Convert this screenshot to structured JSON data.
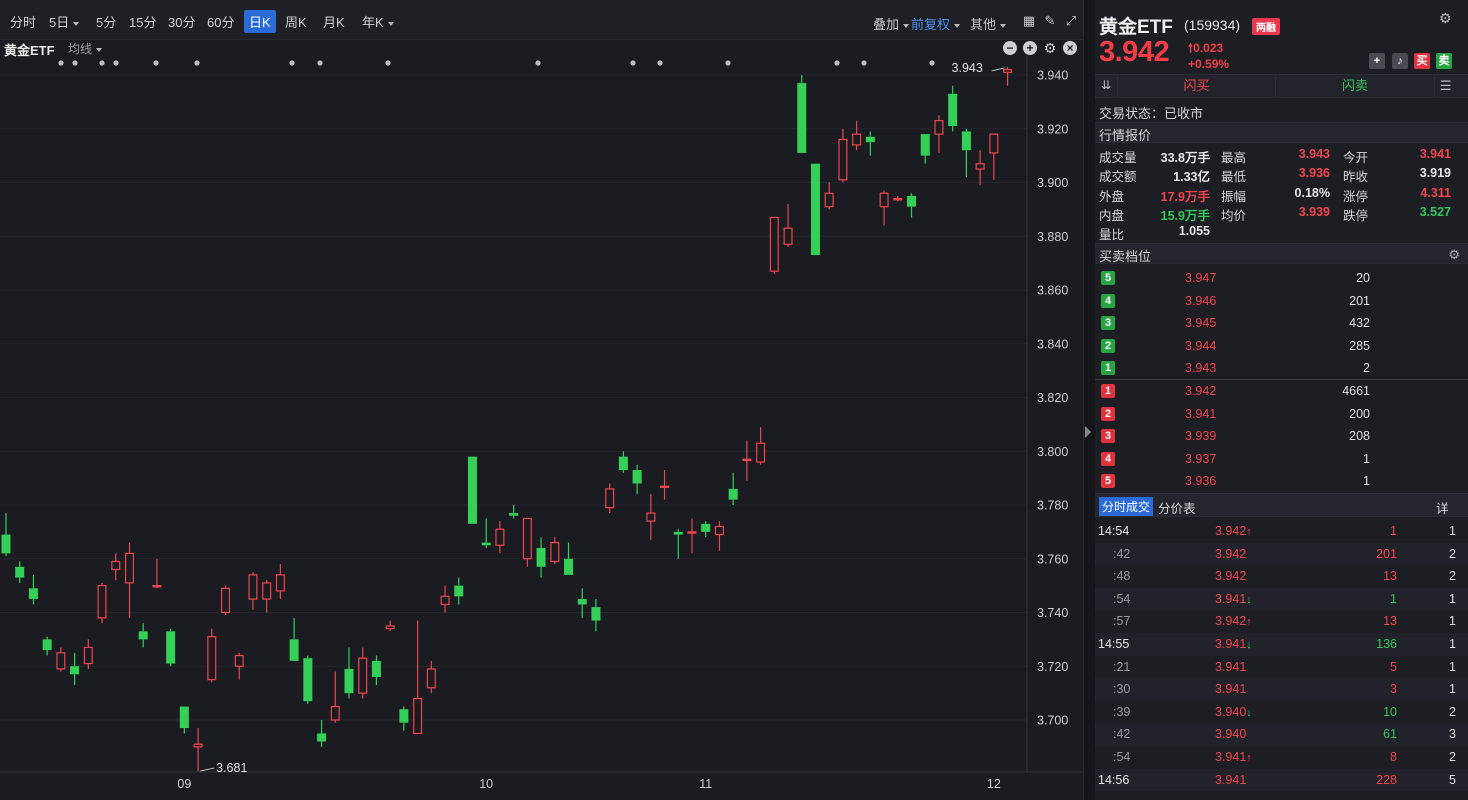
{
  "toolbar": {
    "periods": [
      "分时",
      "5日",
      "5分",
      "15分",
      "30分",
      "60分",
      "日K",
      "周K",
      "月K",
      "年K"
    ],
    "active_period": "日K",
    "overlay_label": "叠加",
    "adjust_label": "前复权",
    "other_label": "其他"
  },
  "chart": {
    "stock_label": "黄金ETF",
    "ma_label": "均线",
    "high_marker": "3.943",
    "low_marker": "3.681"
  },
  "chart_data": {
    "type": "candlestick",
    "y_ticks": [
      "3.940",
      "3.920",
      "3.900",
      "3.880",
      "3.860",
      "3.840",
      "3.820",
      "3.800",
      "3.780",
      "3.760",
      "3.740",
      "3.720",
      "3.700"
    ],
    "ylim": [
      3.68,
      3.945
    ],
    "x_tick_labels": [
      "09",
      "10",
      "11",
      "12"
    ],
    "x_tick_index": [
      13,
      35,
      51,
      72
    ],
    "up_color": "#f0454c",
    "down_color": "#34d058",
    "candles": [
      {
        "o": 3.769,
        "h": 3.777,
        "l": 3.761,
        "c": 3.762
      },
      {
        "o": 3.757,
        "h": 3.759,
        "l": 3.751,
        "c": 3.753
      },
      {
        "o": 3.749,
        "h": 3.754,
        "l": 3.743,
        "c": 3.745
      },
      {
        "o": 3.73,
        "h": 3.731,
        "l": 3.724,
        "c": 3.726
      },
      {
        "o": 3.719,
        "h": 3.727,
        "l": 3.718,
        "c": 3.725
      },
      {
        "o": 3.72,
        "h": 3.725,
        "l": 3.713,
        "c": 3.717
      },
      {
        "o": 3.721,
        "h": 3.73,
        "l": 3.719,
        "c": 3.727
      },
      {
        "o": 3.738,
        "h": 3.751,
        "l": 3.736,
        "c": 3.75
      },
      {
        "o": 3.756,
        "h": 3.762,
        "l": 3.752,
        "c": 3.759
      },
      {
        "o": 3.751,
        "h": 3.766,
        "l": 3.738,
        "c": 3.762
      },
      {
        "o": 3.733,
        "h": 3.736,
        "l": 3.727,
        "c": 3.73
      },
      {
        "o": 3.75,
        "h": 3.76,
        "l": 3.749,
        "c": 3.75
      },
      {
        "o": 3.733,
        "h": 3.734,
        "l": 3.72,
        "c": 3.721
      },
      {
        "o": 3.705,
        "h": 3.705,
        "l": 3.695,
        "c": 3.697
      },
      {
        "o": 3.69,
        "h": 3.697,
        "l": 3.681,
        "c": 3.691
      },
      {
        "o": 3.715,
        "h": 3.734,
        "l": 3.714,
        "c": 3.731
      },
      {
        "o": 3.74,
        "h": 3.75,
        "l": 3.739,
        "c": 3.749
      },
      {
        "o": 3.72,
        "h": 3.725,
        "l": 3.715,
        "c": 3.724
      },
      {
        "o": 3.745,
        "h": 3.755,
        "l": 3.741,
        "c": 3.754
      },
      {
        "o": 3.745,
        "h": 3.752,
        "l": 3.74,
        "c": 3.751
      },
      {
        "o": 3.748,
        "h": 3.758,
        "l": 3.745,
        "c": 3.754
      },
      {
        "o": 3.73,
        "h": 3.738,
        "l": 3.725,
        "c": 3.722
      },
      {
        "o": 3.723,
        "h": 3.724,
        "l": 3.706,
        "c": 3.707
      },
      {
        "o": 3.695,
        "h": 3.7,
        "l": 3.69,
        "c": 3.692
      },
      {
        "o": 3.7,
        "h": 3.718,
        "l": 3.699,
        "c": 3.705
      },
      {
        "o": 3.719,
        "h": 3.727,
        "l": 3.708,
        "c": 3.71
      },
      {
        "o": 3.71,
        "h": 3.727,
        "l": 3.708,
        "c": 3.723
      },
      {
        "o": 3.722,
        "h": 3.724,
        "l": 3.713,
        "c": 3.716
      },
      {
        "o": 3.734,
        "h": 3.737,
        "l": 3.733,
        "c": 3.735
      },
      {
        "o": 3.704,
        "h": 3.705,
        "l": 3.696,
        "c": 3.699
      },
      {
        "o": 3.695,
        "h": 3.737,
        "l": 3.695,
        "c": 3.708
      },
      {
        "o": 3.712,
        "h": 3.722,
        "l": 3.71,
        "c": 3.719
      },
      {
        "o": 3.743,
        "h": 3.75,
        "l": 3.74,
        "c": 3.746
      },
      {
        "o": 3.75,
        "h": 3.753,
        "l": 3.743,
        "c": 3.746
      },
      {
        "o": 3.798,
        "h": 3.798,
        "l": 3.773,
        "c": 3.773
      },
      {
        "o": 3.766,
        "h": 3.775,
        "l": 3.764,
        "c": 3.765
      },
      {
        "o": 3.765,
        "h": 3.774,
        "l": 3.762,
        "c": 3.771
      },
      {
        "o": 3.777,
        "h": 3.78,
        "l": 3.775,
        "c": 3.776
      },
      {
        "o": 3.76,
        "h": 3.774,
        "l": 3.757,
        "c": 3.775
      },
      {
        "o": 3.764,
        "h": 3.768,
        "l": 3.753,
        "c": 3.757
      },
      {
        "o": 3.759,
        "h": 3.768,
        "l": 3.758,
        "c": 3.766
      },
      {
        "o": 3.76,
        "h": 3.766,
        "l": 3.754,
        "c": 3.754
      },
      {
        "o": 3.745,
        "h": 3.749,
        "l": 3.738,
        "c": 3.743
      },
      {
        "o": 3.742,
        "h": 3.745,
        "l": 3.733,
        "c": 3.737
      },
      {
        "o": 3.779,
        "h": 3.788,
        "l": 3.777,
        "c": 3.786
      },
      {
        "o": 3.798,
        "h": 3.8,
        "l": 3.792,
        "c": 3.793
      },
      {
        "o": 3.793,
        "h": 3.795,
        "l": 3.784,
        "c": 3.788
      },
      {
        "o": 3.774,
        "h": 3.784,
        "l": 3.767,
        "c": 3.777
      },
      {
        "o": 3.787,
        "h": 3.793,
        "l": 3.782,
        "c": 3.787
      },
      {
        "o": 3.77,
        "h": 3.771,
        "l": 3.76,
        "c": 3.769
      },
      {
        "o": 3.77,
        "h": 3.775,
        "l": 3.762,
        "c": 3.77
      },
      {
        "o": 3.773,
        "h": 3.774,
        "l": 3.768,
        "c": 3.77
      },
      {
        "o": 3.769,
        "h": 3.774,
        "l": 3.763,
        "c": 3.772
      },
      {
        "o": 3.786,
        "h": 3.792,
        "l": 3.78,
        "c": 3.782
      },
      {
        "o": 3.797,
        "h": 3.804,
        "l": 3.789,
        "c": 3.797
      },
      {
        "o": 3.796,
        "h": 3.809,
        "l": 3.795,
        "c": 3.803
      },
      {
        "o": 3.867,
        "h": 3.887,
        "l": 3.866,
        "c": 3.887
      },
      {
        "o": 3.877,
        "h": 3.892,
        "l": 3.876,
        "c": 3.883
      },
      {
        "o": 3.937,
        "h": 3.94,
        "l": 3.915,
        "c": 3.911
      },
      {
        "o": 3.907,
        "h": 3.907,
        "l": 3.873,
        "c": 3.873
      },
      {
        "o": 3.891,
        "h": 3.9,
        "l": 3.89,
        "c": 3.896
      },
      {
        "o": 3.901,
        "h": 3.92,
        "l": 3.9,
        "c": 3.916
      },
      {
        "o": 3.914,
        "h": 3.923,
        "l": 3.912,
        "c": 3.918
      },
      {
        "o": 3.917,
        "h": 3.919,
        "l": 3.91,
        "c": 3.915
      },
      {
        "o": 3.891,
        "h": 3.897,
        "l": 3.884,
        "c": 3.896
      },
      {
        "o": 3.894,
        "h": 3.895,
        "l": 3.893,
        "c": 3.894
      },
      {
        "o": 3.895,
        "h": 3.896,
        "l": 3.887,
        "c": 3.891
      },
      {
        "o": 3.918,
        "h": 3.918,
        "l": 3.907,
        "c": 3.91
      },
      {
        "o": 3.918,
        "h": 3.925,
        "l": 3.911,
        "c": 3.923
      },
      {
        "o": 3.933,
        "h": 3.936,
        "l": 3.919,
        "c": 3.921
      },
      {
        "o": 3.919,
        "h": 3.92,
        "l": 3.902,
        "c": 3.912
      },
      {
        "o": 3.905,
        "h": 3.912,
        "l": 3.899,
        "c": 3.907
      },
      {
        "o": 3.911,
        "h": 3.918,
        "l": 3.901,
        "c": 3.918
      },
      {
        "o": 3.941,
        "h": 3.943,
        "l": 3.936,
        "c": 3.942
      }
    ]
  },
  "stock": {
    "name": "黄金ETF",
    "code": "(159934)",
    "badge": "两融",
    "price": "3.942",
    "change": "0.023",
    "change_pct": "+0.59%",
    "btn_plus": "+",
    "btn_bell": "♪",
    "btn_buy": "买",
    "btn_sell": "卖"
  },
  "flash": {
    "buy": "闪买",
    "sell": "闪卖"
  },
  "trade_status": "交易状态：已收市",
  "quote": {
    "title": "行情报价",
    "rows": [
      [
        {
          "l": "成交量",
          "v": "33.8万手",
          "c": "#e8e8e8"
        },
        {
          "l": "最高",
          "v": "3.943",
          "c": "#f0454c"
        },
        {
          "l": "今开",
          "v": "3.941",
          "c": "#f0454c"
        }
      ],
      [
        {
          "l": "成交额",
          "v": "1.33亿",
          "c": "#e8e8e8"
        },
        {
          "l": "最低",
          "v": "3.936",
          "c": "#f0454c"
        },
        {
          "l": "昨收",
          "v": "3.919",
          "c": "#e8e8e8"
        }
      ],
      [
        {
          "l": "外盘",
          "v": "17.9万手",
          "c": "#f0454c"
        },
        {
          "l": "振幅",
          "v": "0.18%",
          "c": "#e8e8e8"
        },
        {
          "l": "涨停",
          "v": "4.311",
          "c": "#f0454c"
        }
      ],
      [
        {
          "l": "内盘",
          "v": "15.9万手",
          "c": "#34c759"
        },
        {
          "l": "均价",
          "v": "3.939",
          "c": "#f0454c"
        },
        {
          "l": "跌停",
          "v": "3.527",
          "c": "#34c759"
        }
      ],
      [
        {
          "l": "量比",
          "v": "1.055",
          "c": "#e8e8e8"
        }
      ]
    ]
  },
  "orderbook": {
    "title": "买卖档位",
    "asks": [
      {
        "n": "5",
        "p": "3.947",
        "v": "20"
      },
      {
        "n": "4",
        "p": "3.946",
        "v": "201"
      },
      {
        "n": "3",
        "p": "3.945",
        "v": "432"
      },
      {
        "n": "2",
        "p": "3.944",
        "v": "285"
      },
      {
        "n": "1",
        "p": "3.943",
        "v": "2"
      }
    ],
    "bids": [
      {
        "n": "1",
        "p": "3.942",
        "v": "4661"
      },
      {
        "n": "2",
        "p": "3.941",
        "v": "200"
      },
      {
        "n": "3",
        "p": "3.939",
        "v": "208"
      },
      {
        "n": "4",
        "p": "3.937",
        "v": "1"
      },
      {
        "n": "5",
        "p": "3.936",
        "v": "1"
      }
    ]
  },
  "ticks": {
    "tab_ticks": "分时成交",
    "tab_price": "分价表",
    "tab_detail": "详",
    "rows": [
      {
        "t": "14:54",
        "p": "3.942",
        "a": "↑",
        "v": "1",
        "vc": "#f0454c",
        "n": "1",
        "full": true
      },
      {
        "t": ":42",
        "p": "3.942",
        "a": "",
        "v": "201",
        "vc": "#f0454c",
        "n": "2",
        "full": false
      },
      {
        "t": ":48",
        "p": "3.942",
        "a": "",
        "v": "13",
        "vc": "#f0454c",
        "n": "2",
        "full": false
      },
      {
        "t": ":54",
        "p": "3.941",
        "a": "↓",
        "v": "1",
        "vc": "#34c759",
        "n": "1",
        "full": false
      },
      {
        "t": ":57",
        "p": "3.942",
        "a": "↑",
        "v": "13",
        "vc": "#f0454c",
        "n": "1",
        "full": false
      },
      {
        "t": "14:55",
        "p": "3.941",
        "a": "↓",
        "v": "136",
        "vc": "#34c759",
        "n": "1",
        "full": true
      },
      {
        "t": ":21",
        "p": "3.941",
        "a": "",
        "v": "5",
        "vc": "#f0454c",
        "n": "1",
        "full": false
      },
      {
        "t": ":30",
        "p": "3.941",
        "a": "",
        "v": "3",
        "vc": "#f0454c",
        "n": "1",
        "full": false
      },
      {
        "t": ":39",
        "p": "3.940",
        "a": "↓",
        "v": "10",
        "vc": "#34c759",
        "n": "2",
        "full": false
      },
      {
        "t": ":42",
        "p": "3.940",
        "a": "",
        "v": "61",
        "vc": "#34c759",
        "n": "3",
        "full": false
      },
      {
        "t": ":54",
        "p": "3.941",
        "a": "↑",
        "v": "8",
        "vc": "#f0454c",
        "n": "2",
        "full": false
      },
      {
        "t": "14:56",
        "p": "3.941",
        "a": "",
        "v": "228",
        "vc": "#f0454c",
        "n": "5",
        "full": true
      }
    ]
  }
}
